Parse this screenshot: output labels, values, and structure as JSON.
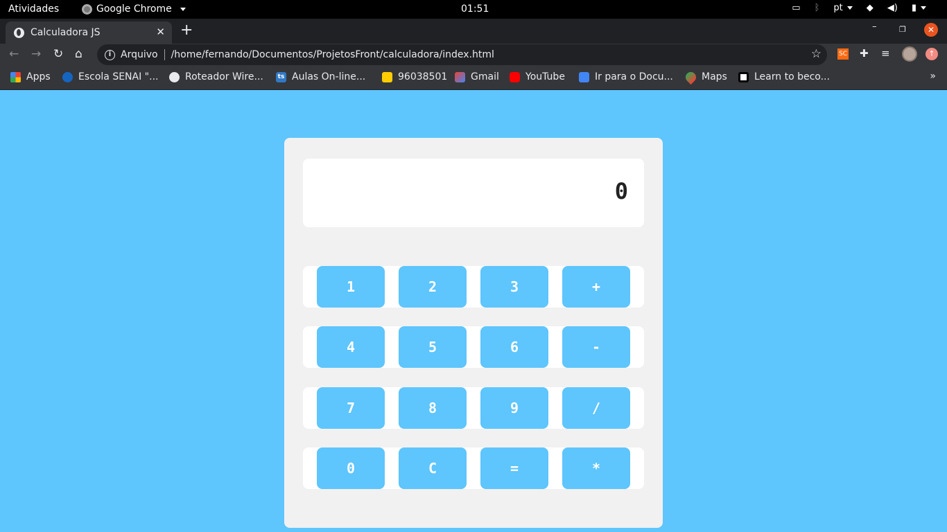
{
  "system_bar": {
    "activities": "Atividades",
    "app_name": "Google Chrome",
    "clock": "01:51",
    "language": "pt"
  },
  "browser": {
    "tab_title": "Calculadora JS",
    "address_scheme": "Arquivo",
    "address_url": "/home/fernando/Documentos/ProjetosFront/calculadora/index.html",
    "extension_sc": "SC",
    "bookmarks": [
      {
        "label": "Apps",
        "icon": "apps-grid-icon"
      },
      {
        "label": "Escola SENAI \"...",
        "icon": "otm-icon"
      },
      {
        "label": "Roteador Wire...",
        "icon": "globe-icon"
      },
      {
        "label": "Aulas On-line...",
        "icon": "ts-icon"
      },
      {
        "label": "96038501",
        "icon": "2048-icon"
      },
      {
        "label": "Gmail",
        "icon": "gmail-icon"
      },
      {
        "label": "YouTube",
        "icon": "youtube-icon"
      },
      {
        "label": "Ir para o Docu...",
        "icon": "docs-icon"
      },
      {
        "label": "Maps",
        "icon": "maps-icon"
      },
      {
        "label": "Learn to beco...",
        "icon": "learn-icon"
      }
    ]
  },
  "calculator": {
    "display_value": "0",
    "rows": [
      [
        "1",
        "2",
        "3",
        "+"
      ],
      [
        "4",
        "5",
        "6",
        "-"
      ],
      [
        "7",
        "8",
        "9",
        "/"
      ],
      [
        "0",
        "C",
        "=",
        "*"
      ]
    ]
  },
  "colors": {
    "page_background": "#5ec5fd",
    "calculator_body": "#f1f1f1",
    "button": "#5ec5fd"
  }
}
